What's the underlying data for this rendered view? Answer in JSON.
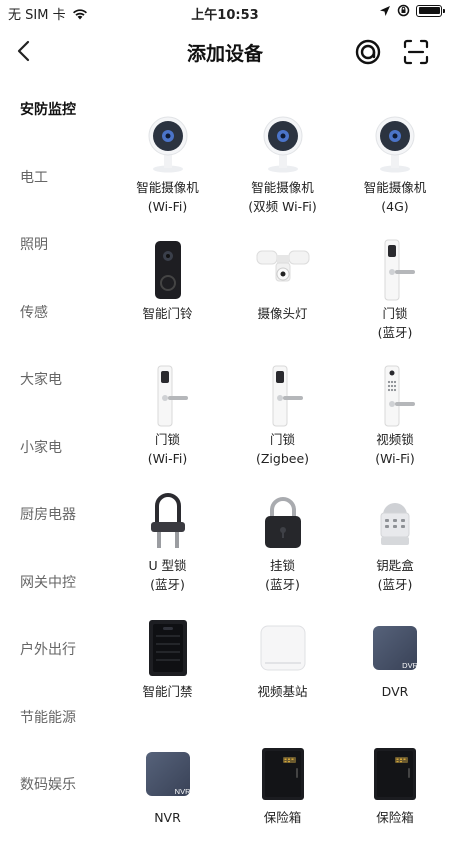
{
  "status_bar": {
    "carrier": "无 SIM 卡",
    "time": "上午10:53"
  },
  "header": {
    "title": "添加设备"
  },
  "sidebar": {
    "items": [
      {
        "label": "安防监控",
        "active": true
      },
      {
        "label": "电工",
        "active": false
      },
      {
        "label": "照明",
        "active": false
      },
      {
        "label": "传感",
        "active": false
      },
      {
        "label": "大家电",
        "active": false
      },
      {
        "label": "小家电",
        "active": false
      },
      {
        "label": "厨房电器",
        "active": false
      },
      {
        "label": "网关中控",
        "active": false
      },
      {
        "label": "户外出行",
        "active": false
      },
      {
        "label": "节能能源",
        "active": false
      },
      {
        "label": "数码娱乐",
        "active": false
      }
    ]
  },
  "devices": [
    {
      "name": "智能摄像机",
      "sub": "(Wi-Fi)",
      "icon": "camera-icon"
    },
    {
      "name": "智能摄像机",
      "sub": "(双频 Wi-Fi)",
      "icon": "camera-icon"
    },
    {
      "name": "智能摄像机",
      "sub": "(4G)",
      "icon": "camera-icon"
    },
    {
      "name": "智能门铃",
      "sub": "",
      "icon": "doorbell-icon"
    },
    {
      "name": "摄像头灯",
      "sub": "",
      "icon": "floodlight-camera-icon"
    },
    {
      "name": "门锁",
      "sub": "(蓝牙)",
      "icon": "door-lock-icon"
    },
    {
      "name": "门锁",
      "sub": "(Wi-Fi)",
      "icon": "door-lock-icon"
    },
    {
      "name": "门锁",
      "sub": "(Zigbee)",
      "icon": "door-lock-icon"
    },
    {
      "name": "视频锁",
      "sub": "(Wi-Fi)",
      "icon": "video-lock-icon"
    },
    {
      "name": "U 型锁",
      "sub": "(蓝牙)",
      "icon": "u-lock-icon"
    },
    {
      "name": "挂锁",
      "sub": "(蓝牙)",
      "icon": "padlock-icon"
    },
    {
      "name": "钥匙盒",
      "sub": "(蓝牙)",
      "icon": "key-box-icon"
    },
    {
      "name": "智能门禁",
      "sub": "",
      "icon": "access-control-icon"
    },
    {
      "name": "视频基站",
      "sub": "",
      "icon": "video-base-station-icon"
    },
    {
      "name": "DVR",
      "sub": "",
      "icon": "dvr-icon",
      "badge": "DVR"
    },
    {
      "name": "NVR",
      "sub": "",
      "icon": "nvr-icon",
      "badge": "NVR"
    },
    {
      "name": "保险箱",
      "sub": "",
      "icon": "safe-icon"
    },
    {
      "name": "保险箱",
      "sub": "",
      "icon": "safe-icon"
    }
  ]
}
